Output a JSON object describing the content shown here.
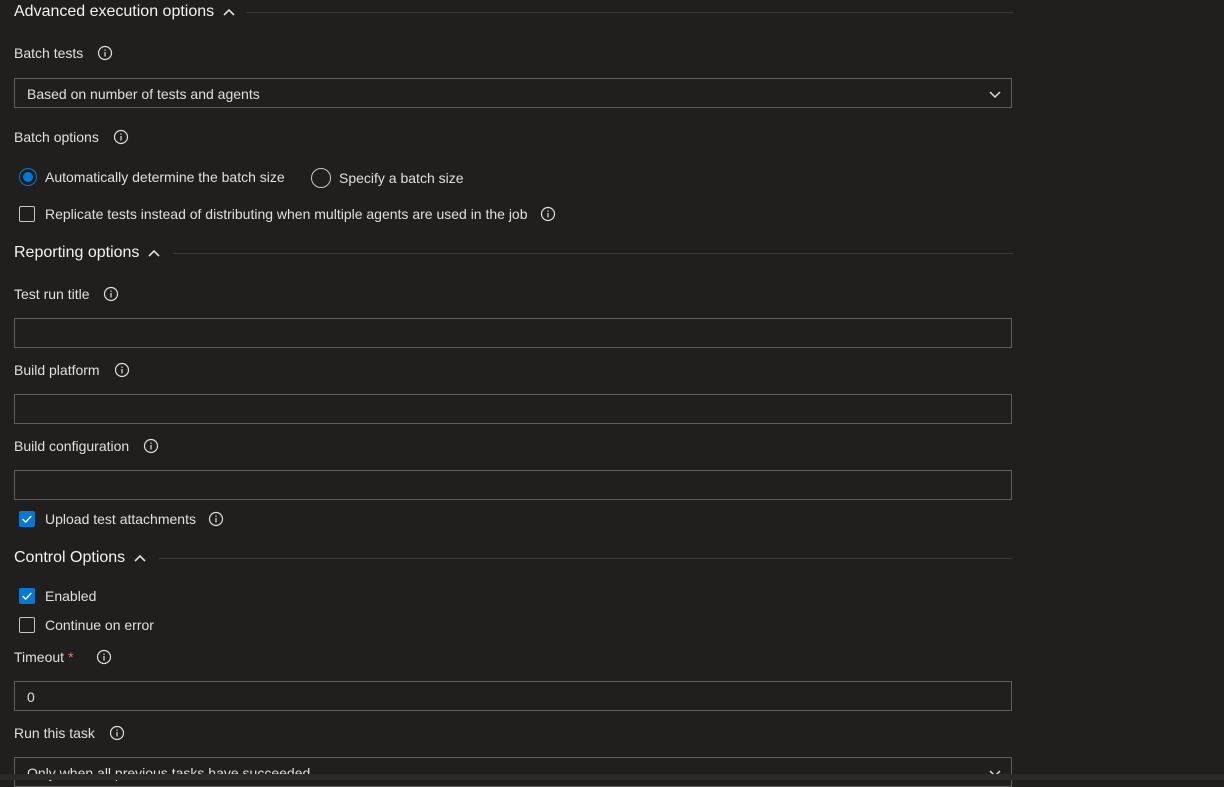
{
  "advanced": {
    "title": "Advanced execution options",
    "batch_tests_label": "Batch tests",
    "batch_tests_value": "Based on number of tests and agents",
    "batch_options_label": "Batch options",
    "radio_auto": "Automatically determine the batch size",
    "radio_specify": "Specify a batch size",
    "replicate_label": "Replicate tests instead of distributing when multiple agents are used in the job"
  },
  "reporting": {
    "title": "Reporting options",
    "test_run_title_label": "Test run title",
    "test_run_title_value": "",
    "build_platform_label": "Build platform",
    "build_platform_value": "",
    "build_configuration_label": "Build configuration",
    "build_configuration_value": "",
    "upload_attachments_label": "Upload test attachments"
  },
  "control": {
    "title": "Control Options",
    "enabled_label": "Enabled",
    "continue_on_error_label": "Continue on error",
    "timeout_label": "Timeout",
    "required_mark": "*",
    "timeout_value": "0",
    "run_task_label": "Run this task",
    "run_task_value": "Only when all previous tasks have succeeded"
  },
  "colors": {
    "background": "#201f1e",
    "accent": "#0078d4",
    "border": "#605e5c",
    "required": "#f1707b"
  },
  "icons": {
    "info": "info-icon",
    "chevron_up": "chevron-up-icon",
    "chevron_down": "chevron-down-icon",
    "check": "checkmark-icon"
  }
}
